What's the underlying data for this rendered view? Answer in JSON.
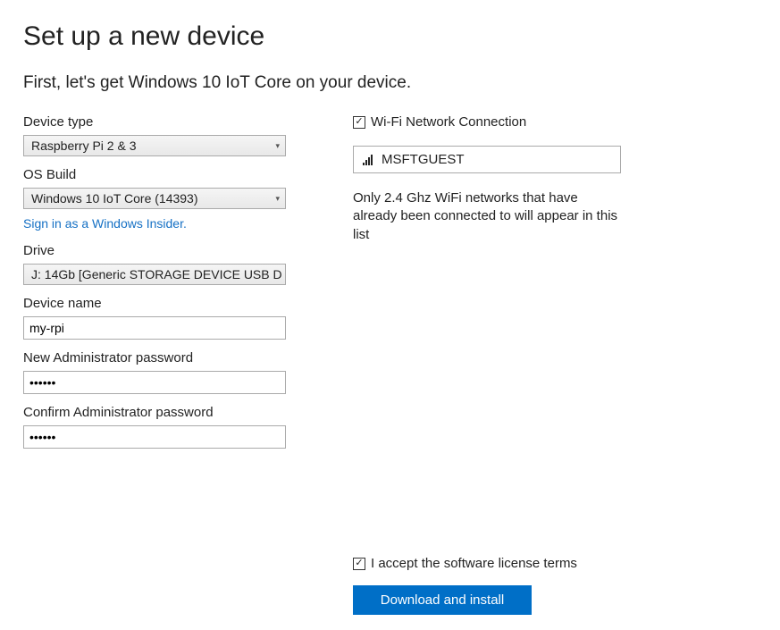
{
  "header": {
    "title": "Set up a new device",
    "subtitle": "First, let's get Windows 10 IoT Core on your device."
  },
  "left": {
    "device_type_label": "Device type",
    "device_type_value": "Raspberry Pi 2 & 3",
    "os_build_label": "OS Build",
    "os_build_value": "Windows 10 IoT Core (14393)",
    "insider_link": "Sign in as a Windows Insider.",
    "drive_label": "Drive",
    "drive_value": "J: 14Gb [Generic STORAGE DEVICE USB D",
    "device_name_label": "Device name",
    "device_name_value": "my-rpi",
    "new_pw_label": "New Administrator password",
    "new_pw_value": "••••••",
    "confirm_pw_label": "Confirm Administrator password",
    "confirm_pw_value": "••••••"
  },
  "right": {
    "wifi_checkbox_label": "Wi-Fi Network Connection",
    "wifi_checked": true,
    "wifi_selected": "MSFTGUEST",
    "wifi_note": "Only 2.4 Ghz WiFi networks that have already been connected to will appear in this list"
  },
  "bottom": {
    "license_label": "I accept the software license terms",
    "license_checked": true,
    "download_button": "Download and install"
  }
}
